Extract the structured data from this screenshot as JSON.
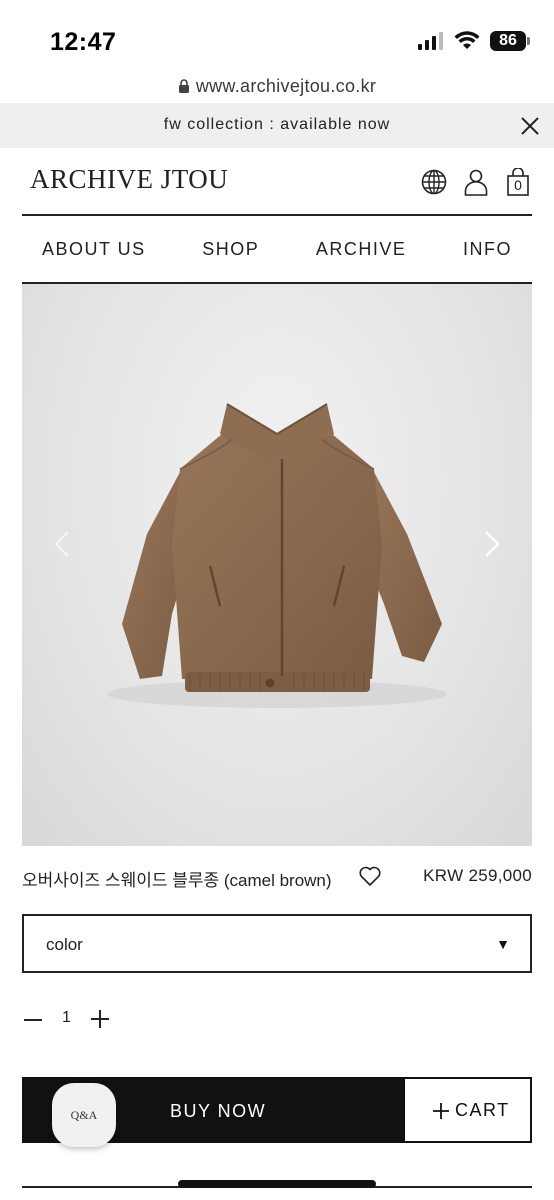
{
  "status_bar": {
    "time": "12:47",
    "battery": "86"
  },
  "browser": {
    "url": "www.archivejtou.co.kr"
  },
  "announcement": {
    "text": "fw collection : available now"
  },
  "header": {
    "logo": "ARCHIVE JTOU",
    "cart_count": "0",
    "icons": [
      "globe-icon",
      "user-icon",
      "shopping-bag-icon"
    ]
  },
  "nav": {
    "items": [
      "ABOUT US",
      "SHOP",
      "ARCHIVE",
      "INFO"
    ]
  },
  "product": {
    "name": "오버사이즈 스웨이드 블루종 (camel brown)",
    "price": "KRW 259,000",
    "image_color": "#8a6a4e"
  },
  "options": {
    "color_label": "color",
    "caret": "▼"
  },
  "quantity": {
    "value": "1"
  },
  "actions": {
    "buy_now": "BUY NOW",
    "cart": "CART",
    "qa": "Q&A"
  }
}
